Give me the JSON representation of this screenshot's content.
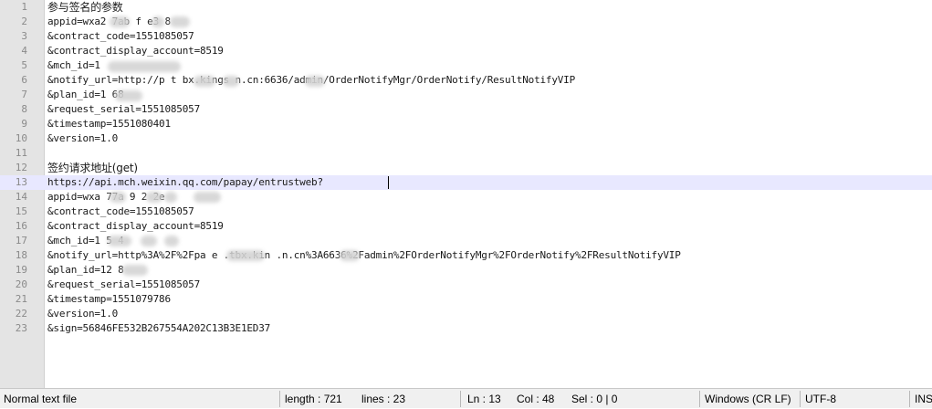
{
  "editor": {
    "lines": [
      {
        "n": "1",
        "text": "参与签名的参数"
      },
      {
        "n": "2",
        "text": "appid=wxa2 7ab f e3 8"
      },
      {
        "n": "3",
        "text": "&contract_code=1551085057"
      },
      {
        "n": "4",
        "text": "&contract_display_account=8519"
      },
      {
        "n": "5",
        "text": "&mch_id=1"
      },
      {
        "n": "6",
        "text": "&notify_url=http://p t bx.kings n.cn:6636/admin/OrderNotifyMgr/OrderNotify/ResultNotifyVIP"
      },
      {
        "n": "7",
        "text": "&plan_id=1 68"
      },
      {
        "n": "8",
        "text": "&request_serial=1551085057"
      },
      {
        "n": "9",
        "text": "&timestamp=1551080401"
      },
      {
        "n": "10",
        "text": "&version=1.0"
      },
      {
        "n": "11",
        "text": ""
      },
      {
        "n": "12",
        "text": "签约请求地址(get)"
      },
      {
        "n": "13",
        "text": "https://api.mch.weixin.qq.com/papay/entrustweb?"
      },
      {
        "n": "14",
        "text": "appid=wxa 77a 9 2 2e"
      },
      {
        "n": "15",
        "text": "&contract_code=1551085057"
      },
      {
        "n": "16",
        "text": "&contract_display_account=8519"
      },
      {
        "n": "17",
        "text": "&mch_id=1 5 4"
      },
      {
        "n": "18",
        "text": "&notify_url=http%3A%2F%2Fpa e .tbx.kin .n.cn%3A6636%2Fadmin%2FOrderNotifyMgr%2FOrderNotify%2FResultNotifyVIP"
      },
      {
        "n": "19",
        "text": "&plan_id=12 8"
      },
      {
        "n": "20",
        "text": "&request_serial=1551085057"
      },
      {
        "n": "21",
        "text": "&timestamp=1551079786"
      },
      {
        "n": "22",
        "text": "&version=1.0"
      },
      {
        "n": "23",
        "text": "&sign=56846FE532B267554A202C13B3E1ED37"
      }
    ]
  },
  "statusbar": {
    "file_type": "Normal text file",
    "length": "length : 721",
    "lines": "lines : 23",
    "ln": "Ln : 13",
    "col": "Col : 48",
    "sel": "Sel : 0 | 0",
    "eol": "Windows (CR LF)",
    "encoding": "UTF-8",
    "ins": "INS"
  },
  "colors": {
    "current_line": "#e8e8ff",
    "gutter": "#e4e4e4",
    "line_number": "#8a8a8a"
  }
}
